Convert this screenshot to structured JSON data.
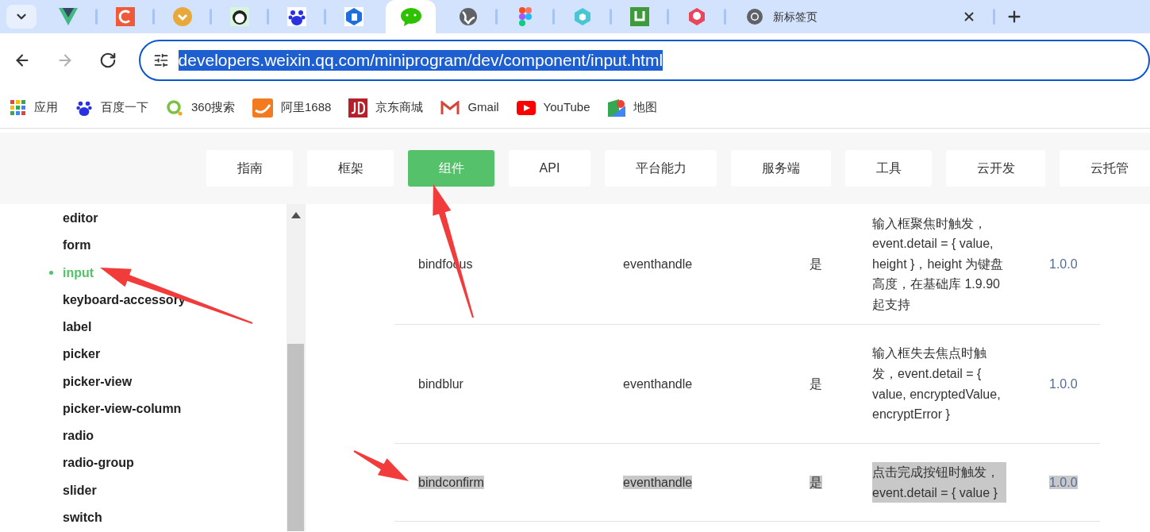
{
  "tabs": [
    {
      "selected": false
    },
    {
      "selected": false
    },
    {
      "selected": false
    },
    {
      "selected": false
    },
    {
      "selected": false
    },
    {
      "selected": false
    },
    {
      "selected": true
    },
    {
      "selected": false
    },
    {
      "selected": false
    },
    {
      "selected": false
    },
    {
      "selected": false
    },
    {
      "selected": false
    },
    {
      "selected": false,
      "title": "新标签页"
    }
  ],
  "nav_buttons": [
    {
      "disabled": false
    },
    {
      "disabled": true
    },
    {
      "disabled": false
    }
  ],
  "address_bar": {
    "url": "developers.weixin.qq.com/miniprogram/dev/component/input.html",
    "selected": true
  },
  "bookmarks": [
    {
      "label": "应用"
    },
    {
      "label": "百度一下"
    },
    {
      "label": "360搜索"
    },
    {
      "label": "阿里1688"
    },
    {
      "label": "京东商城"
    },
    {
      "label": "Gmail"
    },
    {
      "label": "YouTube"
    },
    {
      "label": "地图"
    }
  ],
  "top_nav": [
    {
      "label": "指南",
      "selected": false
    },
    {
      "label": "框架",
      "selected": false
    },
    {
      "label": "组件",
      "selected": true
    },
    {
      "label": "API",
      "selected": false
    },
    {
      "label": "平台能力",
      "selected": false
    },
    {
      "label": "服务端",
      "selected": false
    },
    {
      "label": "工具",
      "selected": false
    },
    {
      "label": "云开发",
      "selected": false
    },
    {
      "label": "云托管",
      "selected": false
    }
  ],
  "sidebar": {
    "items": [
      {
        "label": "editor",
        "selected": false
      },
      {
        "label": "form",
        "selected": false
      },
      {
        "label": "input",
        "selected": true
      },
      {
        "label": "keyboard-accessory",
        "selected": false
      },
      {
        "label": "label",
        "selected": false
      },
      {
        "label": "picker",
        "selected": false
      },
      {
        "label": "picker-view",
        "selected": false
      },
      {
        "label": "picker-view-column",
        "selected": false
      },
      {
        "label": "radio",
        "selected": false
      },
      {
        "label": "radio-group",
        "selected": false
      },
      {
        "label": "slider",
        "selected": false
      },
      {
        "label": "switch",
        "selected": false
      }
    ]
  },
  "table": {
    "rows": [
      {
        "name": "bindfocus",
        "type": "eventhandle",
        "required": "是",
        "description": "输入框聚焦时触发，event.detail = { value, height }，height 为键盘高度，在基础库 1.9.90 起支持",
        "version": "1.0.0",
        "highlighted": false
      },
      {
        "name": "bindblur",
        "type": "eventhandle",
        "required": "是",
        "description": "输入框失去焦点时触发，event.detail = { value, encryptedValue, encryptError }",
        "version": "1.0.0",
        "highlighted": false
      },
      {
        "name": "bindconfirm",
        "type": "eventhandle",
        "required": "是",
        "description": "点击完成按钮时触发，event.detail = { value }",
        "version": "1.0.0",
        "highlighted": true
      }
    ]
  }
}
